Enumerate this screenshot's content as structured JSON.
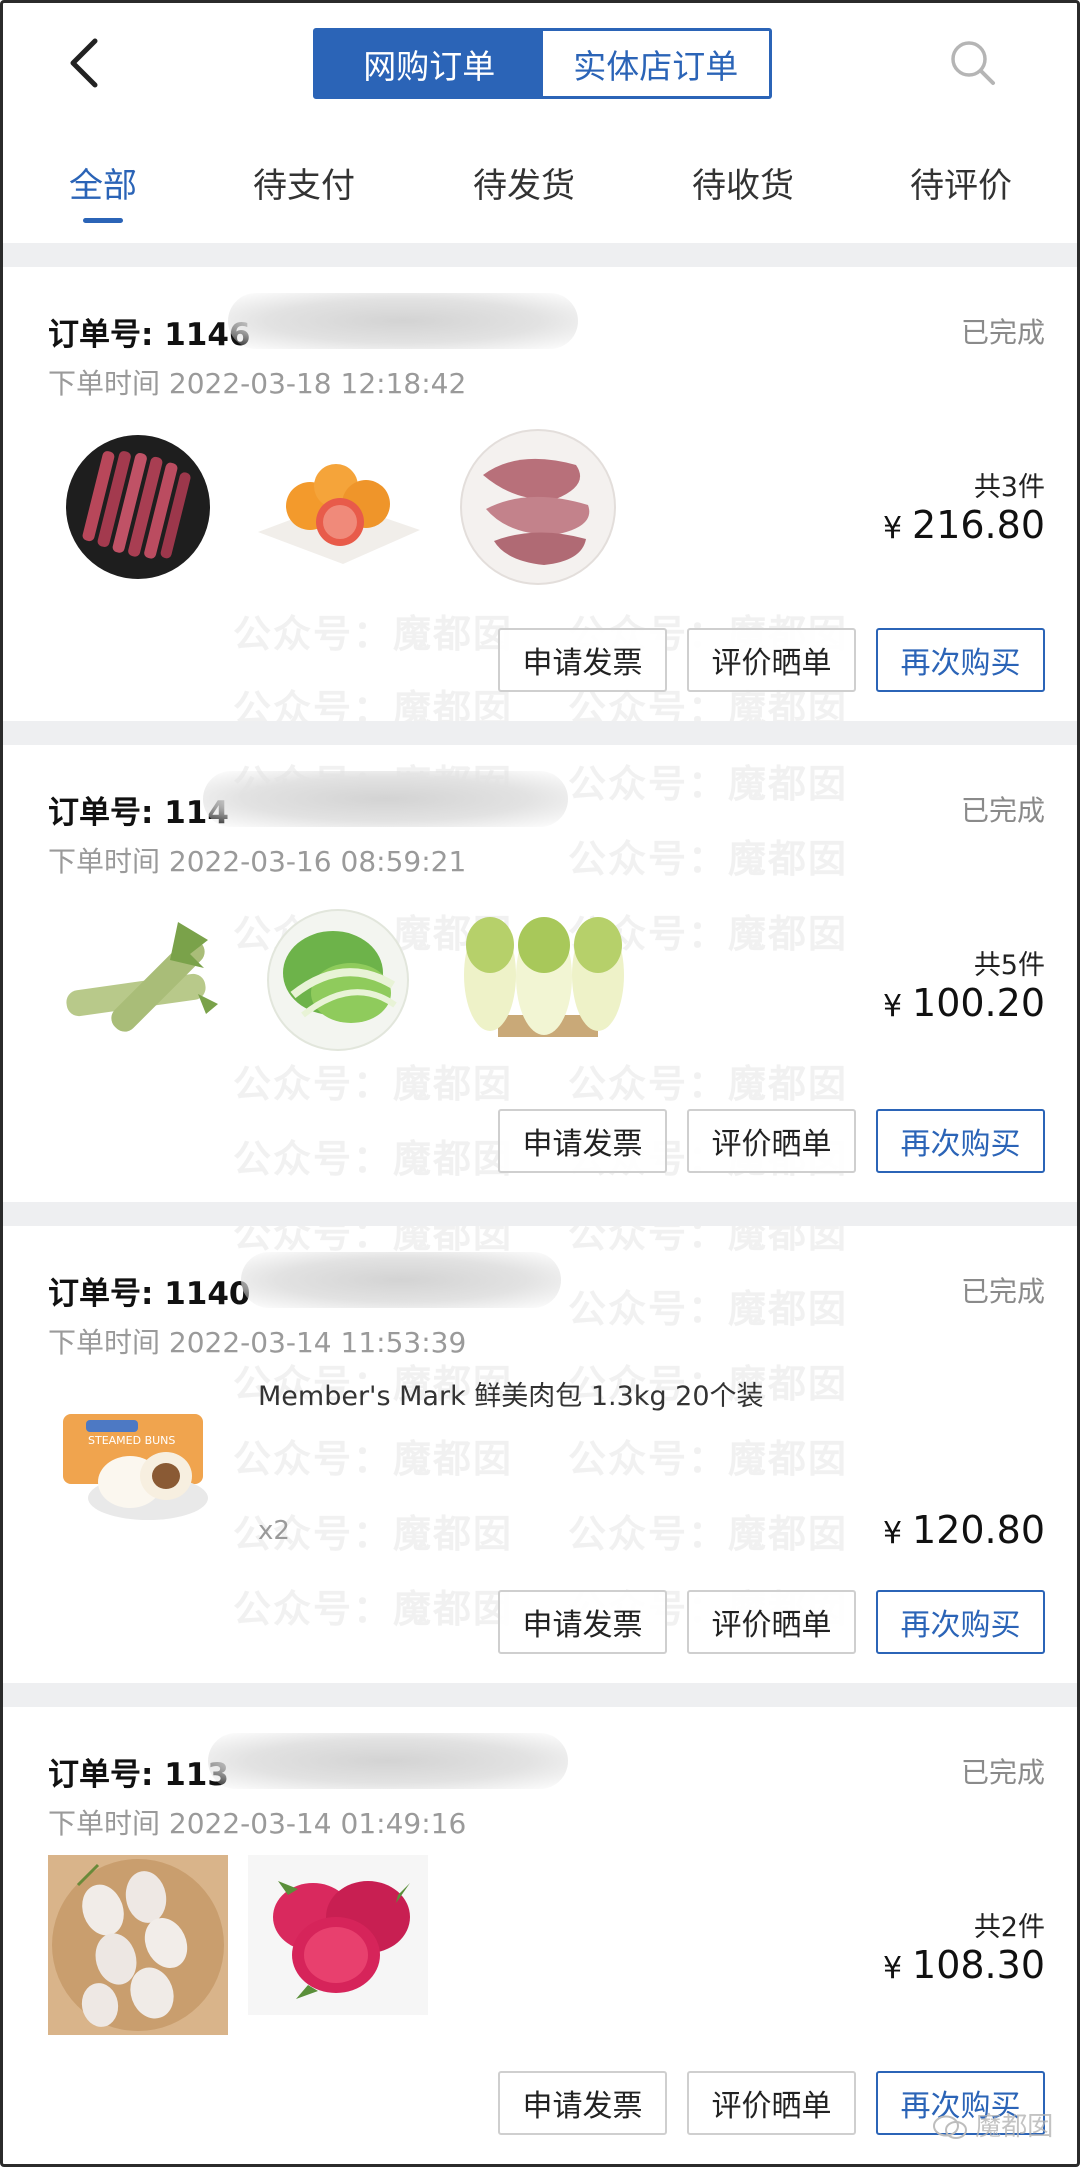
{
  "header": {
    "segment_online": "网购订单",
    "segment_store": "实体店订单"
  },
  "tabs": [
    {
      "label": "全部"
    },
    {
      "label": "待支付"
    },
    {
      "label": "待发货"
    },
    {
      "label": "待收货"
    },
    {
      "label": "待评价"
    }
  ],
  "orders": [
    {
      "order_no": "订单号: 1146",
      "status": "已完成",
      "time": "下单时间 2022-03-18 12:18:42",
      "count": "共3件",
      "currency": "¥",
      "price": "216.80",
      "buttons": [
        "申请发票",
        "评价晒单",
        "再次购买"
      ]
    },
    {
      "order_no": "订单号: 114",
      "status": "已完成",
      "time": "下单时间 2022-03-16 08:59:21",
      "count": "共5件",
      "currency": "¥",
      "price": "100.20",
      "buttons": [
        "申请发票",
        "评价晒单",
        "再次购买"
      ]
    },
    {
      "order_no": "订单号: 1140",
      "status": "已完成",
      "time": "下单时间 2022-03-14 11:53:39",
      "product_name": "Member's Mark 鲜美肉包 1.3kg 20个装",
      "quantity": "x2",
      "currency": "¥",
      "price": "120.80",
      "buttons": [
        "申请发票",
        "评价晒单",
        "再次购买"
      ]
    },
    {
      "order_no": "订单号: 113",
      "status": "已完成",
      "time": "下单时间 2022-03-14 01:49:16",
      "count": "共2件",
      "currency": "¥",
      "price": "108.30",
      "buttons": [
        "申请发票",
        "评价晒单",
        "再次购买"
      ]
    }
  ],
  "watermark": {
    "text_a": "公众号：",
    "text_b": "魔都囡",
    "corner": "魔都囡"
  },
  "colors": {
    "accent": "#2b64b7",
    "divider": "#eeeff1",
    "muted_text": "#9a9a9a"
  },
  "icons": [
    "back-arrow-icon",
    "search-icon",
    "wechat-icon"
  ]
}
